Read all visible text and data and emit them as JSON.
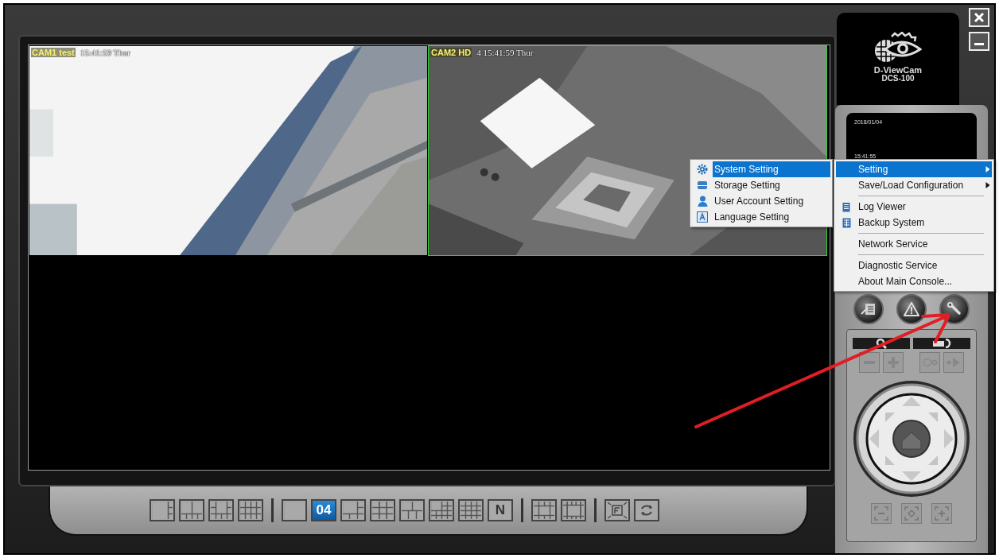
{
  "logo": {
    "name": "D-ViewCam",
    "model": "DCS-100"
  },
  "clock": {
    "date": "2018/01/04",
    "time": "15:41:55"
  },
  "cameras": [
    {
      "label": "CAM1 test",
      "timestamp": "15:41:59 Thur",
      "selected": false
    },
    {
      "label": "CAM2 HD",
      "timestamp": "4 15:41:59 Thur",
      "selected": true
    }
  ],
  "menu": {
    "items": [
      {
        "kind": "item",
        "label": "Setting",
        "submenu": true,
        "selected": true
      },
      {
        "kind": "item",
        "label": "Save/Load Configuration",
        "submenu": true,
        "selected": false
      },
      {
        "kind": "separator"
      },
      {
        "kind": "log",
        "label": "Log Viewer",
        "submenu": false,
        "selected": false
      },
      {
        "kind": "backup",
        "label": "Backup System",
        "submenu": false,
        "selected": false
      },
      {
        "kind": "separator"
      },
      {
        "kind": "item",
        "label": "Network Service",
        "submenu": false,
        "selected": false
      },
      {
        "kind": "separator"
      },
      {
        "kind": "item",
        "label": "Diagnostic Service",
        "submenu": false,
        "selected": false
      },
      {
        "kind": "item",
        "label": "About Main Console...",
        "submenu": false,
        "selected": false
      }
    ]
  },
  "submenu": {
    "items": [
      {
        "kind": "gear",
        "label": "System Setting",
        "selected": true
      },
      {
        "kind": "storage",
        "label": "Storage Setting",
        "selected": false
      },
      {
        "kind": "user",
        "label": "User Account Setting",
        "selected": false
      },
      {
        "kind": "language",
        "label": "Language Setting",
        "selected": false
      }
    ]
  },
  "toolbar": {
    "groups": [
      [
        {
          "kind": "l1r3",
          "selected": false
        },
        {
          "kind": "t2b4",
          "selected": false
        },
        {
          "kind": "c1e8",
          "selected": false
        },
        {
          "kind": "g12",
          "selected": false
        }
      ],
      [
        {
          "kind": "g1",
          "selected": false
        },
        {
          "kind": "label",
          "label": "04",
          "selected": true
        },
        {
          "kind": "l1r2b",
          "selected": false
        },
        {
          "kind": "g9",
          "selected": false
        },
        {
          "kind": "t4b6",
          "selected": false
        },
        {
          "kind": "g13",
          "selected": false
        },
        {
          "kind": "g16",
          "selected": false
        },
        {
          "kind": "label",
          "label": "N",
          "selected": false
        }
      ],
      [
        {
          "kind": "ring12",
          "selected": false
        },
        {
          "kind": "ring16",
          "selected": false
        }
      ],
      [
        {
          "kind": "fullscreen",
          "selected": false
        },
        {
          "kind": "cycle",
          "selected": false
        }
      ]
    ]
  }
}
